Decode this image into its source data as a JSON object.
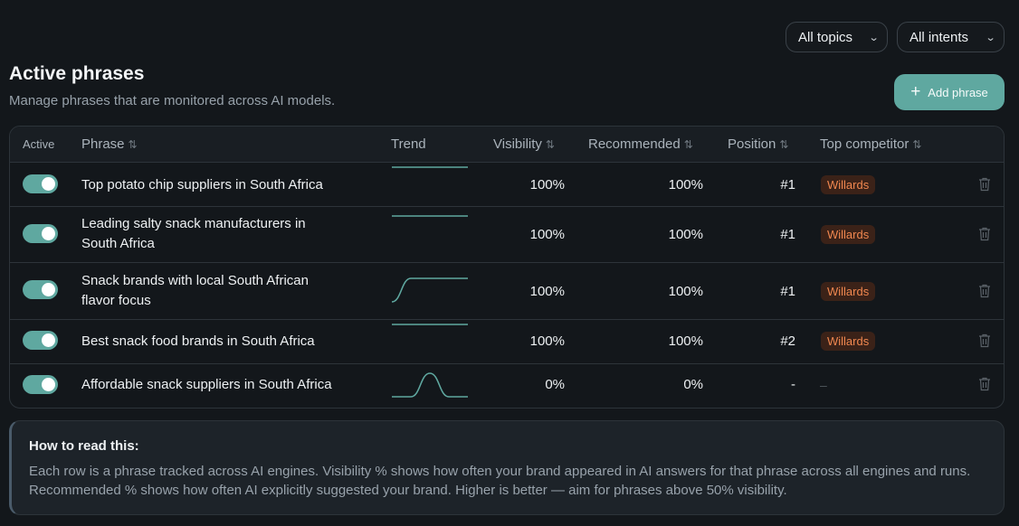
{
  "filters": {
    "topics": "All topics",
    "intents": "All intents"
  },
  "header": {
    "title": "Active phrases",
    "subtitle": "Manage phrases that are monitored across AI models.",
    "add_button": "Add phrase"
  },
  "table": {
    "columns": {
      "active": "Active",
      "phrase": "Phrase",
      "trend": "Trend",
      "visibility": "Visibility",
      "recommended": "Recommended",
      "position": "Position",
      "top_competitor": "Top competitor"
    },
    "rows": [
      {
        "active": true,
        "phrase": "Top potato chip suppliers in South Africa",
        "trend": [
          100,
          100,
          100,
          100,
          100
        ],
        "visibility": "100%",
        "recommended": "100%",
        "position": "#1",
        "competitor": "Willards"
      },
      {
        "active": true,
        "phrase": "Leading salty snack manufacturers in South Africa",
        "trend": [
          100,
          100,
          100,
          100,
          100
        ],
        "visibility": "100%",
        "recommended": "100%",
        "position": "#1",
        "competitor": "Willards"
      },
      {
        "active": true,
        "phrase": "Snack brands with local South African flavor focus",
        "trend": [
          0,
          100,
          100,
          100,
          100
        ],
        "visibility": "100%",
        "recommended": "100%",
        "position": "#1",
        "competitor": "Willards"
      },
      {
        "active": true,
        "phrase": "Best snack food brands in South Africa",
        "trend": [
          100,
          100,
          100,
          100,
          100
        ],
        "visibility": "100%",
        "recommended": "100%",
        "position": "#2",
        "competitor": "Willards"
      },
      {
        "active": true,
        "phrase": "Affordable snack suppliers in South Africa",
        "trend": [
          0,
          0,
          100,
          0,
          0
        ],
        "visibility": "0%",
        "recommended": "0%",
        "position": "-",
        "competitor": "–"
      }
    ]
  },
  "info": {
    "title": "How to read this:",
    "body": "Each row is a phrase tracked across AI engines. Visibility % shows how often your brand appeared in AI answers for that phrase across all engines and runs. Recommended % shows how often AI explicitly suggested your brand. Higher is better — aim for phrases above 50% visibility."
  },
  "colors": {
    "accent": "#5fa8a0",
    "badge_bg": "#3b2218",
    "badge_text": "#f0874f"
  },
  "icons": {
    "sort": "sort-arrows-icon",
    "chevron": "chevron-down-icon",
    "plus": "plus-icon",
    "delete": "trash-icon"
  }
}
